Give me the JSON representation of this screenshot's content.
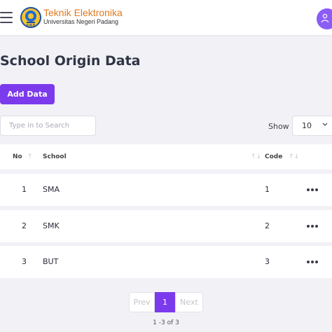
{
  "header": {
    "brand_title": "Teknik Elektronika",
    "brand_subtitle": "Universitas Negeri Padang",
    "logo_text": "U.N.P.",
    "accent": "#7c3aed",
    "brand_color": "#e07a1f"
  },
  "page": {
    "title": "School Origin Data",
    "add_label": "Add Data"
  },
  "filters": {
    "search_placeholder": "Type in to Search",
    "search_value": "",
    "show_label": "Show",
    "show_value": "10"
  },
  "table": {
    "columns": [
      "No",
      "School",
      "Code"
    ],
    "rows": [
      {
        "no": "1",
        "school": "SMA",
        "code": "1"
      },
      {
        "no": "2",
        "school": "SMK",
        "code": "2"
      },
      {
        "no": "3",
        "school": "BUT",
        "code": "3"
      }
    ]
  },
  "pagination": {
    "prev": "Prev",
    "current": "1",
    "next": "Next",
    "summary": "1 -3 of 3"
  },
  "icons": [
    "menu-icon",
    "user-icon",
    "chevron-down-icon",
    "sort-icon",
    "more-icon"
  ]
}
